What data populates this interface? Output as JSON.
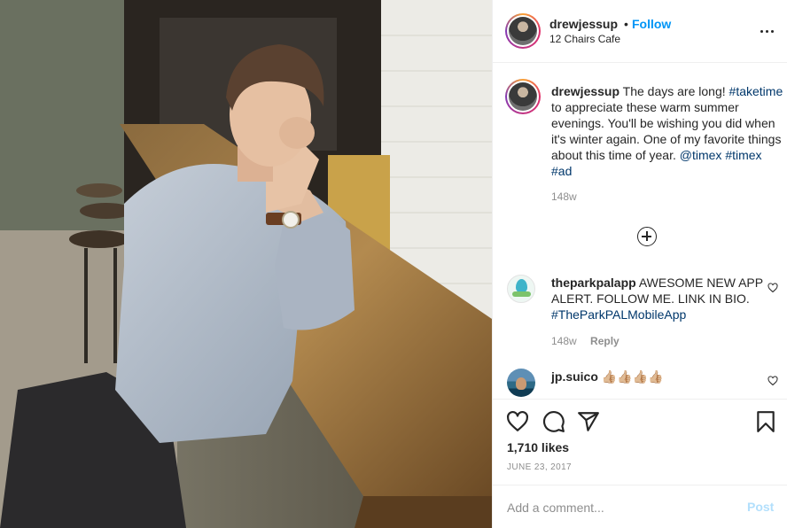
{
  "header": {
    "username": "drewjessup",
    "separator": "•",
    "follow_label": "Follow",
    "location": "12 Chairs Cafe",
    "more_icon": "more-horizontal-icon"
  },
  "caption": {
    "username": "drewjessup",
    "text_1": "The days are long!",
    "hashtag_1": "#taketime",
    "text_2": "to appreciate these warm summer evenings. You'll be wishing you did when it's winter again. One of my favorite things about this time of year.",
    "mention": "@timex",
    "hashtag_2": "#timex",
    "hashtag_3": "#ad",
    "age": "148w"
  },
  "load_more_icon": "plus-circle-icon",
  "comments": [
    {
      "username": "theparkpalapp",
      "text": "AWESOME NEW APP ALERT. FOLLOW ME. LINK IN BIO.",
      "hashtag": "#TheParkPALMobileApp",
      "age": "148w",
      "reply_label": "Reply"
    },
    {
      "username": "jp.suico",
      "text": "👍🏼👍🏼👍🏼👍🏼"
    }
  ],
  "actions": {
    "icons": [
      "heart-icon",
      "comment-icon",
      "share-icon",
      "bookmark-icon"
    ]
  },
  "likes": "1,710 likes",
  "date": "JUNE 23, 2017",
  "add_comment": {
    "placeholder": "Add a comment...",
    "post_label": "Post",
    "post_color": "#b2dffc"
  },
  "colors": {
    "link": "#0095f6",
    "hashtag": "#00376b",
    "muted": "#8e8e8e"
  }
}
